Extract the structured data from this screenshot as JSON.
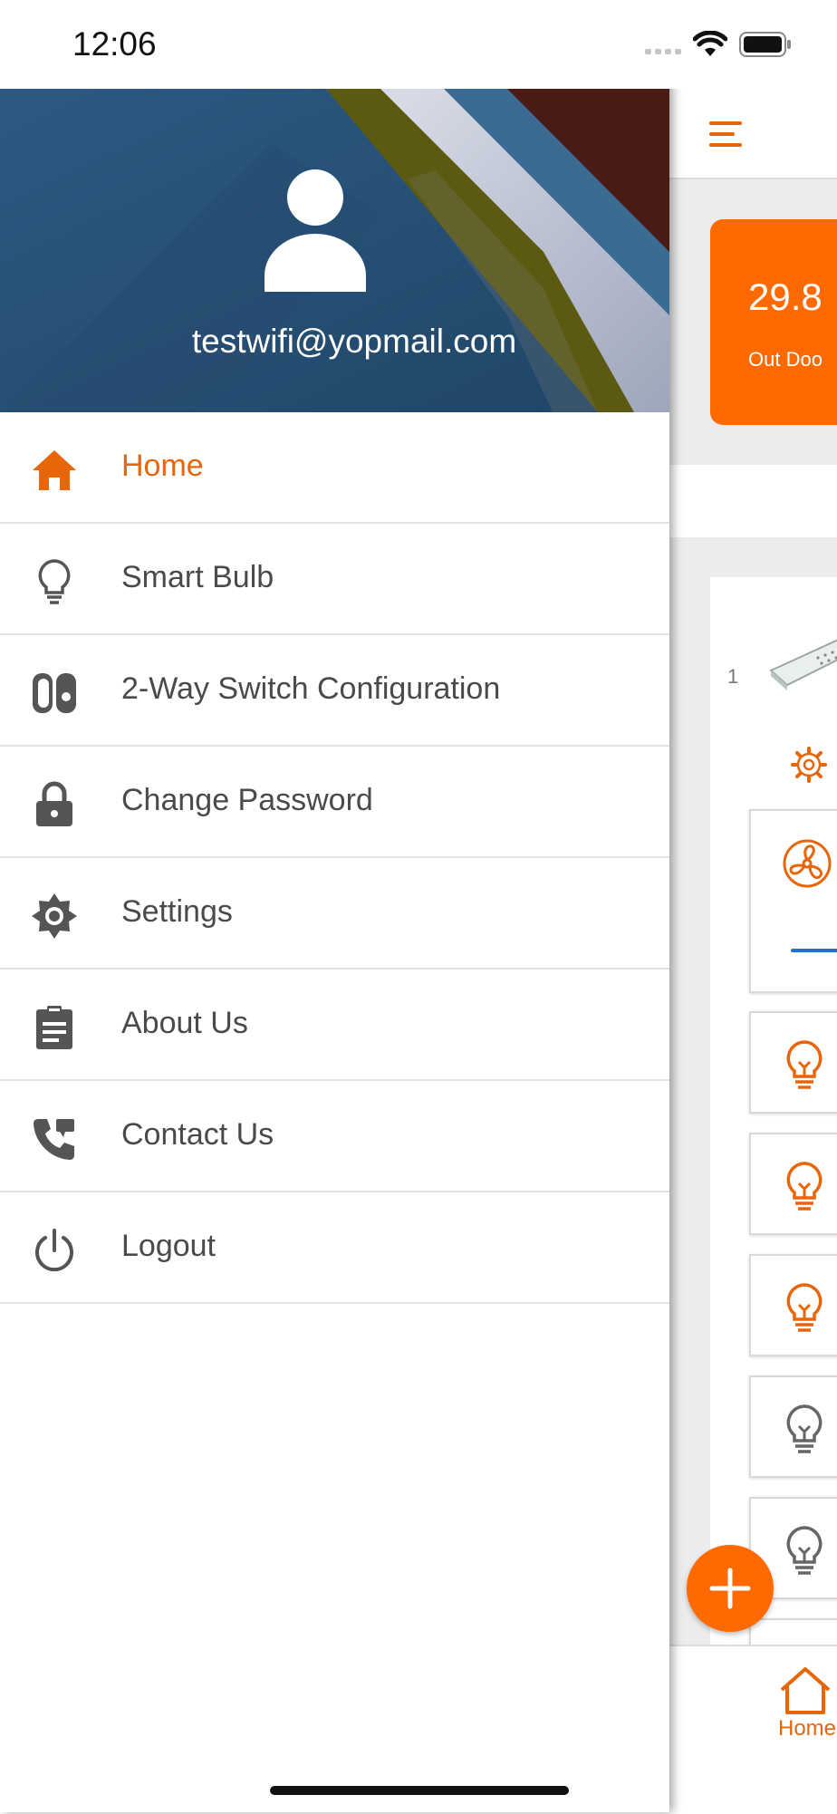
{
  "status_bar": {
    "time": "12:06"
  },
  "drawer": {
    "user_email": "testwifi@yopmail.com",
    "items": [
      {
        "label": "Home",
        "icon": "home-icon",
        "active": true
      },
      {
        "label": "Smart Bulb",
        "icon": "bulb-icon"
      },
      {
        "label": "2-Way Switch Configuration",
        "icon": "switch-icon"
      },
      {
        "label": "Change Password",
        "icon": "lock-icon"
      },
      {
        "label": "Settings",
        "icon": "gear-icon"
      },
      {
        "label": "About Us",
        "icon": "clipboard-icon"
      },
      {
        "label": "Contact Us",
        "icon": "phone-icon"
      },
      {
        "label": "Logout",
        "icon": "power-icon"
      }
    ]
  },
  "main": {
    "temperature": "29.8",
    "temperature_label": "Out Doo",
    "device_index": "1",
    "bottom_nav_home": "Home"
  },
  "colors": {
    "accent": "#ff6a00",
    "text": "#4a4a4a",
    "fan_indicator": "#1e6fd9"
  }
}
